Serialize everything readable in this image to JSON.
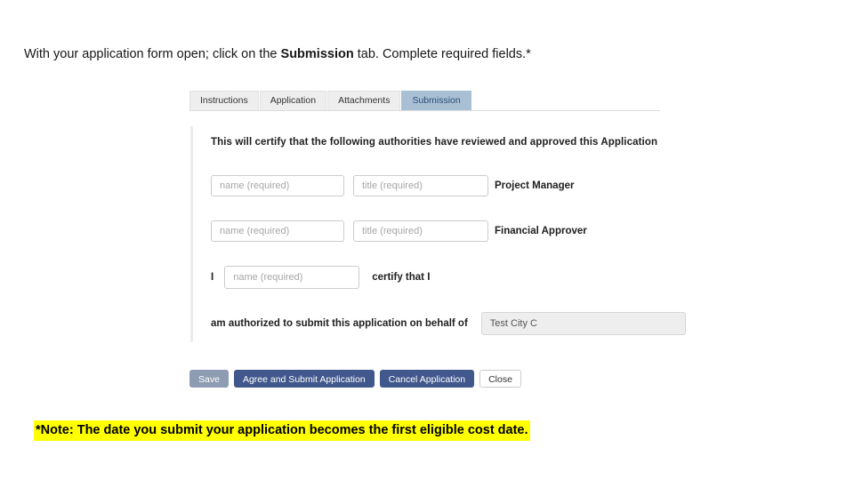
{
  "instruction": {
    "before": "With your application form open; click on the ",
    "bold": "Submission",
    "after": " tab. Complete required fields.*"
  },
  "tabs": [
    {
      "label": "Instructions",
      "active": false
    },
    {
      "label": "Application",
      "active": false
    },
    {
      "label": "Attachments",
      "active": false
    },
    {
      "label": "Submission",
      "active": true
    }
  ],
  "form": {
    "heading": "This will certify that the following authorities have reviewed and approved this Application",
    "rows": [
      {
        "name_placeholder": "name (required)",
        "name_value": "",
        "title_placeholder": "title (required)",
        "title_value": "",
        "role": "Project Manager"
      },
      {
        "name_placeholder": "name (required)",
        "name_value": "",
        "title_placeholder": "title (required)",
        "title_value": "",
        "role": "Financial Approver"
      }
    ],
    "certify": {
      "prefix": "I",
      "name_placeholder": "name (required)",
      "name_value": "",
      "suffix": "certify that I"
    },
    "behalf": {
      "label": "am authorized to submit this application on behalf of",
      "organization": "Test City C"
    }
  },
  "buttons": [
    {
      "label": "Save",
      "style": "disabled"
    },
    {
      "label": "Agree and Submit Application",
      "style": "primary"
    },
    {
      "label": "Cancel Application",
      "style": "primary"
    },
    {
      "label": "Close",
      "style": "secondary"
    }
  ],
  "footnote": "*Note: The date you submit your application becomes the first eligible cost date.",
  "colors": {
    "active_tab_bg": "#a9c0d4",
    "active_tab_text": "#2c4f74",
    "primary_button": "#41588c",
    "disabled_button": "#8d9cb0",
    "highlight": "#ffff00"
  }
}
